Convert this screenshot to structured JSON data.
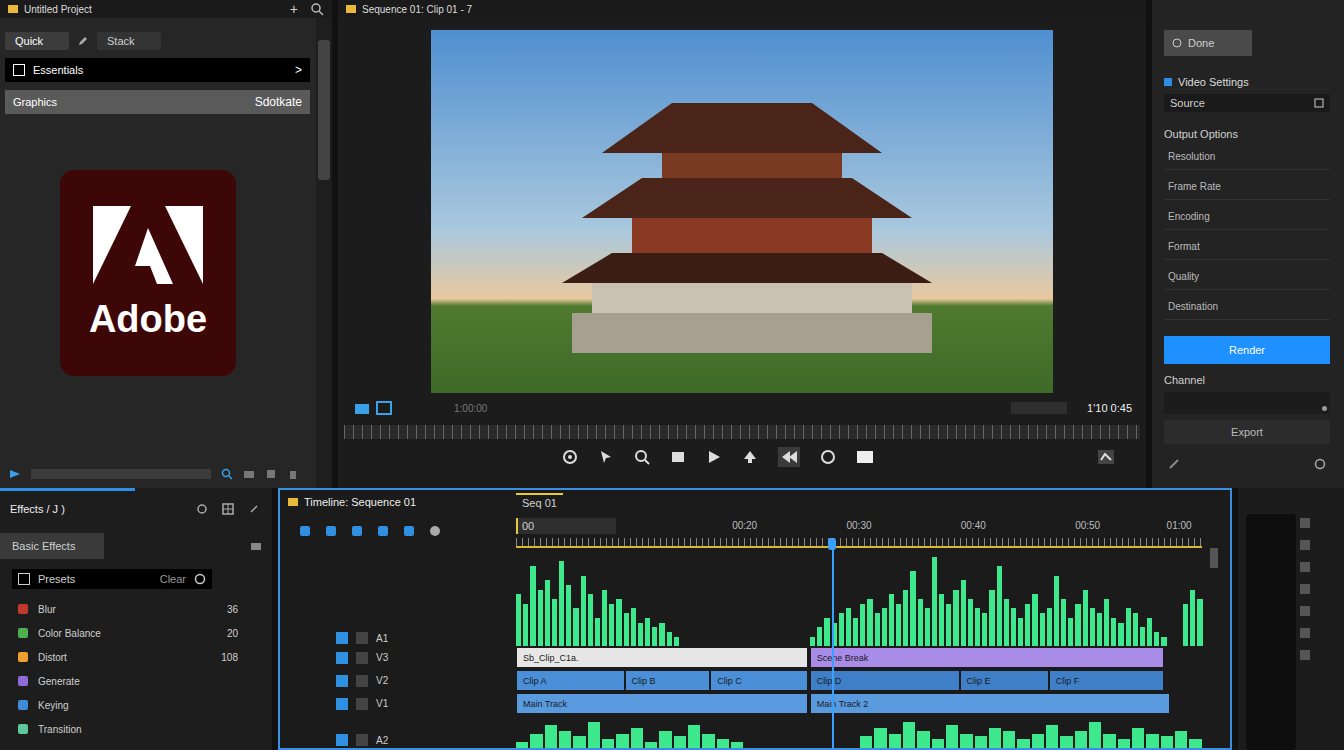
{
  "project": {
    "title": "Untitled Project",
    "add": "+"
  },
  "media_tabs": [
    {
      "label": "Quick",
      "selected": true
    },
    {
      "label": "Stack",
      "selected": false
    }
  ],
  "media_rows": [
    {
      "label": "Essentials",
      "trail": ">",
      "kind": "nav",
      "selected": false
    },
    {
      "label": "Graphics",
      "trail": "Sdotkate",
      "kind": "item",
      "selected": true
    }
  ],
  "logo": {
    "text": "Adobe"
  },
  "viewer": {
    "title": "Sequence 01: Clip 01 - 7",
    "timecode": "1:00:00",
    "readout": "1'10 0:45"
  },
  "inspector": {
    "top_button": "Done",
    "section": "Video Settings",
    "field": "Source",
    "heading": "Output Options",
    "rows": [
      "Resolution",
      "Frame Rate",
      "Encoding",
      "Format",
      "Quality",
      "Destination"
    ],
    "primary": "Render",
    "label": "Channel",
    "level": 0.95,
    "secondary": "Export"
  },
  "effects": {
    "title": "Effects / J )",
    "tab": "Basic Effects",
    "header": {
      "label": "Presets",
      "value": "Clear"
    },
    "items": [
      {
        "label": "Blur",
        "count": "36",
        "color": "#c0392b"
      },
      {
        "label": "Color Balance",
        "count": "20",
        "color": "#4caf50"
      },
      {
        "label": "Distort",
        "count": "108",
        "color": "#f0a030"
      },
      {
        "label": "Generate",
        "color": "#8e6bd6"
      },
      {
        "label": "Keying",
        "color": "#3d8bd9"
      },
      {
        "label": "Transition",
        "color": "#5cc7a0"
      }
    ]
  },
  "timeline": {
    "title": "Timeline: Sequence 01",
    "tabs": [
      {
        "label": "Seq 01",
        "selected": true
      }
    ],
    "start_box": "00",
    "length": 60,
    "playhead": 27.6,
    "ruler": [
      {
        "text": "00:20",
        "at": 20
      },
      {
        "text": "00:30",
        "at": 30
      },
      {
        "text": "00:40",
        "at": 40
      },
      {
        "text": "00:50",
        "at": 50
      },
      {
        "text": "01:00",
        "at": 58
      }
    ],
    "tracks": [
      {
        "name": "A1",
        "kind": "audio",
        "values": [
          0.55,
          0.45,
          0.85,
          0.6,
          0.7,
          0.5,
          0.9,
          0.65,
          0.4,
          0.75,
          0.55,
          0.3,
          0.6,
          0.45,
          0.5,
          0.35,
          0.4,
          0.25,
          0.3,
          0.2,
          0.25,
          0.15,
          0.1,
          0,
          0,
          0,
          0,
          0,
          0,
          0,
          0,
          0,
          0,
          0,
          0,
          0,
          0,
          0,
          0,
          0,
          0,
          0.1,
          0.2,
          0.3,
          0.25,
          0.35,
          0.4,
          0.3,
          0.45,
          0.5,
          0.35,
          0.4,
          0.55,
          0.45,
          0.6,
          0.8,
          0.5,
          0.4,
          0.95,
          0.55,
          0.45,
          0.6,
          0.7,
          0.5,
          0.4,
          0.35,
          0.6,
          0.85,
          0.5,
          0.4,
          0.3,
          0.45,
          0.55,
          0.35,
          0.4,
          0.75,
          0.5,
          0.3,
          0.45,
          0.6,
          0.4,
          0.35,
          0.5,
          0.3,
          0.25,
          0.4,
          0.35,
          0.2,
          0.3,
          0.15,
          0.1,
          0,
          0,
          0.45,
          0.6,
          0.5
        ]
      },
      {
        "name": "V3",
        "kind": "clips",
        "clips": [
          {
            "label": "Sb_Clip_C1a.",
            "start": 0,
            "duration": 25.5,
            "color": "#e6e6e6"
          },
          {
            "label": "Scene Break",
            "start": 25.7,
            "duration": 31,
            "color": "#a98be8"
          }
        ]
      },
      {
        "name": "V2",
        "kind": "clips",
        "clips": [
          {
            "label": "Clip A",
            "start": 0,
            "duration": 9.5,
            "color": "#4a8fd8"
          },
          {
            "label": "Clip B",
            "start": 9.5,
            "duration": 7.5,
            "color": "#4a8fd8"
          },
          {
            "label": "Clip C",
            "start": 17,
            "duration": 8.5,
            "color": "#4a8fd8"
          },
          {
            "label": "Clip D",
            "start": 25.7,
            "duration": 13.1,
            "color": "#3f7fc8"
          },
          {
            "label": "Clip E",
            "start": 38.8,
            "duration": 7.8,
            "color": "#3f7fc8"
          },
          {
            "label": "Clip F",
            "start": 46.6,
            "duration": 10.1,
            "color": "#3f7fc8"
          }
        ]
      },
      {
        "name": "V1",
        "kind": "clips",
        "clips": [
          {
            "label": "Main Track",
            "start": 0,
            "duration": 25.5,
            "color": "#5a9be0"
          },
          {
            "label": "Main Track 2",
            "start": 25.7,
            "duration": 31.5,
            "color": "#5a9be0"
          }
        ]
      },
      {
        "name": "A2",
        "kind": "audio",
        "values": [
          0.2,
          0.5,
          0.8,
          0.6,
          0.4,
          0.9,
          0.3,
          0.5,
          0.7,
          0.2,
          0.6,
          0.4,
          0.8,
          0.5,
          0.3,
          0.2,
          0,
          0,
          0,
          0,
          0,
          0,
          0,
          0,
          0.4,
          0.7,
          0.5,
          0.9,
          0.6,
          0.3,
          0.8,
          0.5,
          0.4,
          0.7,
          0.6,
          0.3,
          0.5,
          0.8,
          0.4,
          0.6,
          0.9,
          0.5,
          0.3,
          0.7,
          0.5,
          0.4,
          0.6,
          0.3
        ]
      }
    ]
  }
}
